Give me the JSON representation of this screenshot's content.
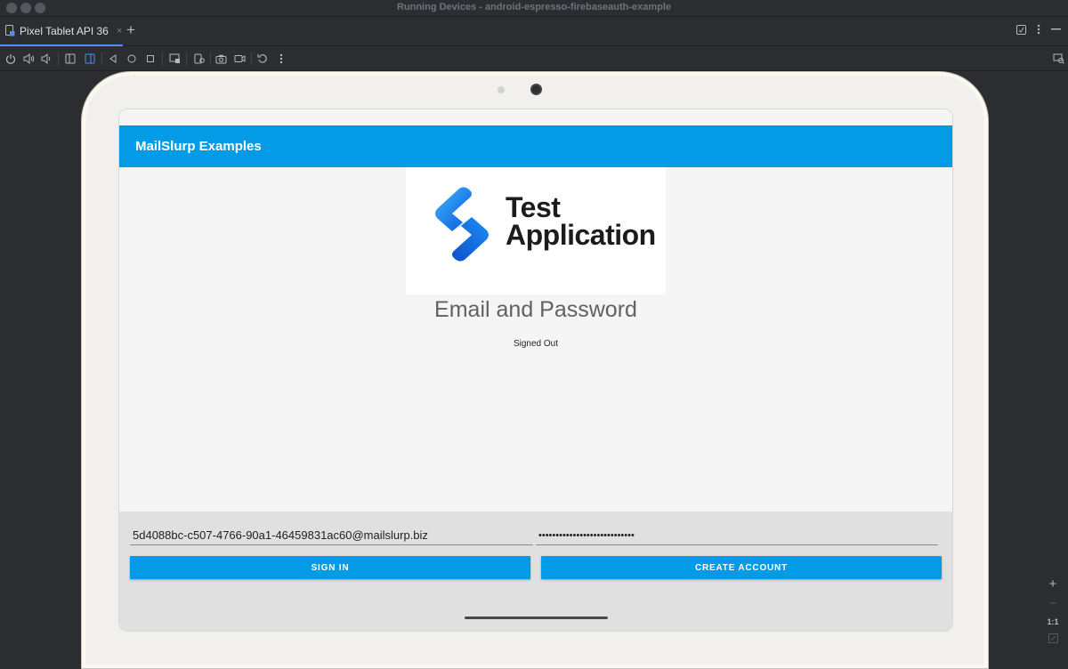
{
  "window": {
    "title": "Running Devices - android-espresso-firebaseauth-example"
  },
  "tabs": [
    {
      "label": "Pixel Tablet API 36",
      "close": "×"
    }
  ],
  "add_tab": "+",
  "tabbar_icons": [
    "window-icon",
    "more-vertical-icon",
    "minimize-icon"
  ],
  "toolbar_icons": [
    "power-icon",
    "volume-up-icon",
    "volume-down-icon",
    "rotate-left-icon",
    "rotate-right-icon",
    "back-icon",
    "home-icon",
    "overview-icon",
    "screenshot-icon",
    "device-record-icon",
    "camera-icon",
    "video-icon",
    "reset-icon",
    "more-icon"
  ],
  "app": {
    "toolbar_title": "MailSlurp Examples",
    "logo": {
      "line1": "Test",
      "line2": "Application"
    },
    "heading": "Email and Password",
    "status": "Signed Out",
    "email_value": "5d4088bc-c507-4766-90a1-46459831ac60@mailslurp.biz",
    "password_value": "••••••••••••••••••••••••••••",
    "sign_in_label": "SIGN IN",
    "create_account_label": "CREATE ACCOUNT"
  },
  "zoom": {
    "in": "+",
    "out": "−",
    "actual": "1:1"
  },
  "colors": {
    "accent": "#039be5",
    "ide_bg": "#2b2d30",
    "tablet_frame": "#f2f0ec"
  }
}
